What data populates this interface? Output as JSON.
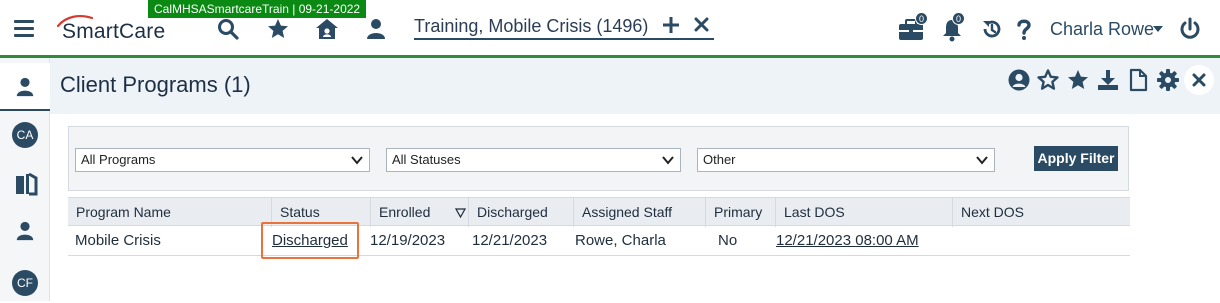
{
  "environment_badge": "CalMHSASmartcareTrain | 09-21-2022",
  "app": {
    "name": "SmartCare"
  },
  "client_tab": {
    "label": "Training, Mobile Crisis (1496)"
  },
  "notifications": {
    "briefcase_count": "0",
    "bell_count": "0"
  },
  "user": {
    "name": "Charla Rowe"
  },
  "page": {
    "title": "Client Programs (1)"
  },
  "leftnav": {
    "items": [
      {
        "label": "CA"
      },
      {
        "label": "CF"
      }
    ]
  },
  "filters": {
    "program": "All Programs",
    "status": "All Statuses",
    "other": "Other",
    "apply_label": "Apply Filter"
  },
  "table": {
    "columns": [
      "Program Name",
      "Status",
      "Enrolled",
      "Discharged",
      "Assigned Staff",
      "Primary",
      "Last DOS",
      "Next DOS"
    ],
    "rows": [
      {
        "program_name": "Mobile Crisis",
        "status": "Discharged",
        "enrolled": "12/19/2023",
        "discharged": "12/21/2023",
        "assigned_staff": "Rowe, Charla",
        "primary": "No",
        "last_dos": "12/21/2023 08:00 AM",
        "next_dos": ""
      }
    ]
  },
  "colors": {
    "brand_navy": "#2b4a63",
    "env_green": "#0a8a12",
    "highlight": "#e8743b"
  }
}
